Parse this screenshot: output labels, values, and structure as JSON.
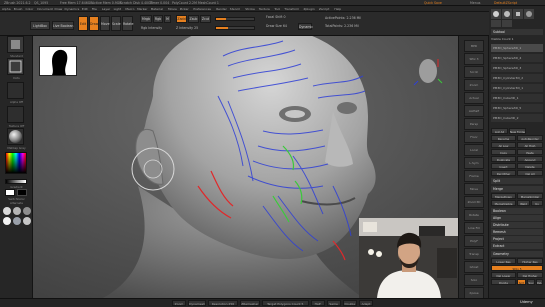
{
  "titlebar": {
    "title": "ZBrush 2021.6.2",
    "segments": [
      "QS_1095",
      "Free Mem 17.646GB",
      "Active Mem 0.9GB",
      "Scratch Disk 4.40GB",
      "Timer 0.004",
      "PolyCount 2.2M",
      "MeshCount 1"
    ],
    "right_label": "Quick Save",
    "menus_link": "Menus",
    "script_label": "DefaultZScript"
  },
  "menubar": {
    "items": [
      "Alpha",
      "Brush",
      "Color",
      "Document",
      "Draw",
      "Dynamics",
      "Edit",
      "File",
      "Layer",
      "Light",
      "Macro",
      "Marker",
      "Material",
      "Movie",
      "Picker",
      "Preferences",
      "Render",
      "Stencil",
      "Stroke",
      "Texture",
      "Tool",
      "Transform",
      "Zplugin",
      "Zscript",
      "Help"
    ]
  },
  "toolbar": {
    "lightbox_label": "LightBox",
    "live_boolean_label": "Live Boolean",
    "edit_label": "Edit",
    "draw_label": "Draw",
    "move_label": "Move",
    "scale_label": "Scale",
    "rotate_label": "Rotate",
    "mrgb_label": "Mrgb",
    "rgb_label": "Rgb",
    "m_label": "M",
    "zadd_label": "Zadd",
    "zsub_label": "Zsub",
    "zcut_label": "Zcut",
    "rgb_intensity_label": "Rgb Intensity",
    "z_intensity_label": "Z Intensity 25",
    "focal_shift_label": "Focal Shift 0",
    "draw_size_label": "Draw Size 64",
    "dynamic_label": "Dynamic",
    "active_points_label": "ActivePoints: 2.236 Mil",
    "total_points_label": "TotalPoints: 2.236 Mil"
  },
  "leftshelf": {
    "labels": [
      "Standard",
      "Dots",
      "Alpha Off",
      "Texture Off",
      "MatCap Gray",
      "Gradient",
      "SwitchColor",
      "Alternate"
    ]
  },
  "tray": {
    "icons": [
      "BPR",
      "SPix 3",
      "Scroll",
      "Zoom",
      "Actual",
      "AAHalf",
      "Persp",
      "Floor",
      "Local",
      "L.Sym",
      "Frame",
      "Move",
      "Zoom3D",
      "Rotate",
      "Line Fill",
      "PolyF",
      "Transp",
      "Ghost",
      "Solo",
      "Xpose"
    ]
  },
  "palette": {
    "header": "Subtool",
    "visible_count": "Visible Count 1",
    "subtools": [
      "PM3D_Sphere3D_1",
      "PM3D_Sphere3D_4",
      "PM3D_Sphere3D_3",
      "PM3D_Cylinder3D_2",
      "PM3D_Cylinder3D_1",
      "PM3D_Cube3D_1",
      "PM3D_Sphere3D_5",
      "PM3D_Cube3D_2"
    ],
    "list_all": "List All",
    "new_folder": "New Folder",
    "rename": "Rename",
    "auto_reorder": "AutoReorder",
    "all_low": "All Low",
    "all_high": "All High",
    "copy": "Copy",
    "paste": "Paste",
    "duplicate": "Duplicate",
    "append": "Append",
    "insert": "Insert",
    "delete": "Delete",
    "del_other": "Del Other",
    "del_all": "Del All",
    "split": "Split",
    "merge": "Merge",
    "merge_down": "MergeDown",
    "merge_similar": "MergeSimilar",
    "merge_visible": "MergeVisible",
    "weld": "Weld",
    "uv": "Uv",
    "boolean": "Boolean",
    "align": "Align",
    "distribute": "Distribute",
    "remesh": "Remesh",
    "project": "Project",
    "extract": "Extract",
    "geometry": "Geometry",
    "lower_res": "Lower Res",
    "higher_res": "Higher Res",
    "sdiv": "SDiv 5",
    "del_lower": "Del Lower",
    "del_higher": "Del Higher",
    "divide": "Divide",
    "smt": "Smt",
    "suv": "Suv",
    "reuv": "ReUV"
  },
  "bottombar": {
    "items": [
      "Zoom",
      "Dynamesh",
      "Resolution 256",
      "ZRemesher",
      "Target Polygons Count 5",
      "Half",
      "Same",
      "Double",
      "Adapt"
    ]
  },
  "watermark": "Udemy",
  "colors": {
    "accent": "#e6801f",
    "stroke_blue": "#2f3fd6",
    "stroke_green": "#3bc93b",
    "stroke_red": "#e0282a"
  }
}
